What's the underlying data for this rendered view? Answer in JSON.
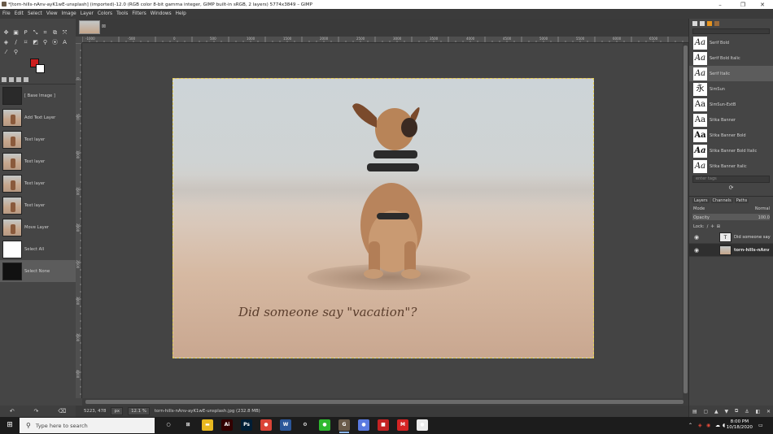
{
  "window": {
    "title": "*[torn-hills-nAnv-ayK1wE-unsplash] (imported)-12.0 (RGB color 8-bit gamma integer, GIMP built-in sRGB, 2 layers) 5774x3849 – GIMP",
    "minimize_glyph": "–",
    "maximize_glyph": "❐",
    "close_glyph": "✕"
  },
  "menu": [
    "File",
    "Edit",
    "Select",
    "View",
    "Image",
    "Layer",
    "Colors",
    "Tools",
    "Filters",
    "Windows",
    "Help"
  ],
  "colors": {
    "foreground": "#cc1e1e",
    "background": "#ffffff",
    "selection_outline": "#e6d35a"
  },
  "history": {
    "items": [
      {
        "label": "[ Base Image ]"
      },
      {
        "label": "Add Text Layer"
      },
      {
        "label": "Text layer"
      },
      {
        "label": "Text layer"
      },
      {
        "label": "Text layer"
      },
      {
        "label": "Text layer"
      },
      {
        "label": "Move Layer"
      },
      {
        "label": "Select All"
      },
      {
        "label": "Select None"
      }
    ],
    "footer": [
      "↶",
      "↷",
      "⌫"
    ]
  },
  "ruler": {
    "h_labels": [
      "-1000",
      "-500",
      "0",
      "500",
      "1000",
      "1500",
      "2000",
      "2500",
      "3000",
      "3500",
      "4000",
      "4500",
      "5000",
      "5500",
      "6000",
      "6500"
    ],
    "v_labels": [
      "0",
      "500",
      "1000",
      "1500",
      "2000",
      "2500",
      "3000",
      "3500",
      "4000"
    ]
  },
  "canvas": {
    "text_layer": "Did someone say \"vacation\"?"
  },
  "status": {
    "coords": "5223, 478",
    "unit": "px",
    "zoom": "12.1 %",
    "info": "torn-hills-nAnv-ayK1wE-unsplash.jpg (232.8 MB)"
  },
  "fonts": {
    "items": [
      {
        "glyph": "Aa",
        "name": "Serif Bold"
      },
      {
        "glyph": "Aa",
        "name": "Serif Bold Italic"
      },
      {
        "glyph": "Aa",
        "name": "Serif Italic"
      },
      {
        "glyph": "永",
        "name": "SimSun"
      },
      {
        "glyph": "Aa",
        "name": "SimSun-ExtB"
      },
      {
        "glyph": "Aa",
        "name": "Sitka Banner"
      },
      {
        "glyph": "Aa",
        "name": "Sitka Banner Bold"
      },
      {
        "glyph": "Aa",
        "name": "Sitka Banner Bold Italic"
      },
      {
        "glyph": "Aa",
        "name": "Sitka Banner Italic"
      }
    ],
    "tags_placeholder": "enter tags",
    "refresh_glyph": "⟳"
  },
  "layers": {
    "tabs": [
      "Layers",
      "Channels",
      "Paths"
    ],
    "mode_label": "Mode",
    "mode_value": "Normal",
    "opacity_label": "Opacity",
    "opacity_value": "100.0",
    "lock_label": "Lock:",
    "items": [
      {
        "name": "Did someone say",
        "thumb": "T"
      },
      {
        "name": "torn-hills-nAnv",
        "thumb": ""
      }
    ]
  },
  "taskbar": {
    "search_placeholder": "Type here to search",
    "time": "8:00 PM",
    "date": "10/18/2020",
    "apps": [
      {
        "name": "cortana-icon",
        "glyph": "○",
        "color": "#1c1c1c"
      },
      {
        "name": "task-view-icon",
        "glyph": "⊞",
        "color": "#1c1c1c"
      },
      {
        "name": "file-explorer-icon",
        "glyph": "▬",
        "color": "#e8b820"
      },
      {
        "name": "illustrator-icon",
        "glyph": "Ai",
        "color": "#330000"
      },
      {
        "name": "photoshop-icon",
        "glyph": "Ps",
        "color": "#001e36"
      },
      {
        "name": "chrome-icon",
        "glyph": "●",
        "color": "#db4437"
      },
      {
        "name": "word-icon",
        "glyph": "W",
        "color": "#2b579a"
      },
      {
        "name": "settings-icon",
        "glyph": "⚙",
        "color": "#1c1c1c"
      },
      {
        "name": "app-green-icon",
        "glyph": "●",
        "color": "#2eb82e"
      },
      {
        "name": "gimp-icon",
        "glyph": "G",
        "color": "#6a5b4a"
      },
      {
        "name": "browser-icon",
        "glyph": "●",
        "color": "#5a7ae0"
      },
      {
        "name": "app-red-icon",
        "glyph": "■",
        "color": "#c42323"
      },
      {
        "name": "app-shield-icon",
        "glyph": "M",
        "color": "#d42424"
      },
      {
        "name": "app-white-icon",
        "glyph": "●",
        "color": "#ececec"
      }
    ]
  }
}
